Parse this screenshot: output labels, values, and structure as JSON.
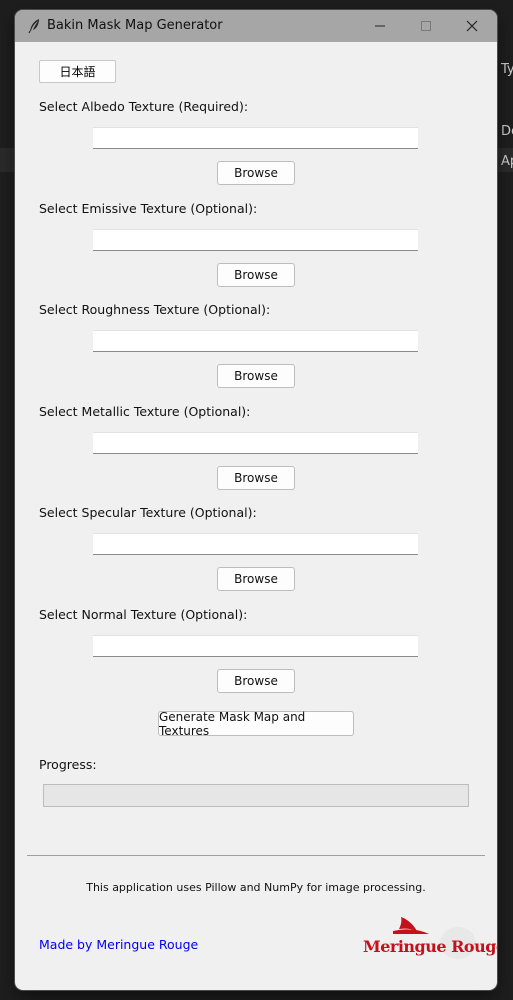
{
  "window": {
    "title": "Bakin Mask Map Generator",
    "language_button": "日本語"
  },
  "fields": [
    {
      "label": "Select Albedo Texture (Required):",
      "value": "",
      "browse": "Browse"
    },
    {
      "label": "Select Emissive Texture (Optional):",
      "value": "",
      "browse": "Browse"
    },
    {
      "label": "Select Roughness Texture (Optional):",
      "value": "",
      "browse": "Browse"
    },
    {
      "label": "Select Metallic Texture (Optional):",
      "value": "",
      "browse": "Browse"
    },
    {
      "label": "Select Specular Texture (Optional):",
      "value": "",
      "browse": "Browse"
    },
    {
      "label": "Select Normal Texture (Optional):",
      "value": "",
      "browse": "Browse"
    }
  ],
  "generate_button": "Generate Mask Map and Textures",
  "progress": {
    "label": "Progress:",
    "value": 0
  },
  "footer": {
    "info": "This application uses Pillow and NumPy for image processing.",
    "made_by": "Made by Meringue Rouge",
    "logo_text": "Meringue Rouge"
  },
  "background_app": {
    "fragments": [
      "Ty",
      "De",
      "Ap"
    ]
  },
  "colors": {
    "titlebar": "#a6a6a6",
    "window_bg": "#f0f0f0",
    "link": "#0000ee",
    "logo": "#c4111b"
  }
}
